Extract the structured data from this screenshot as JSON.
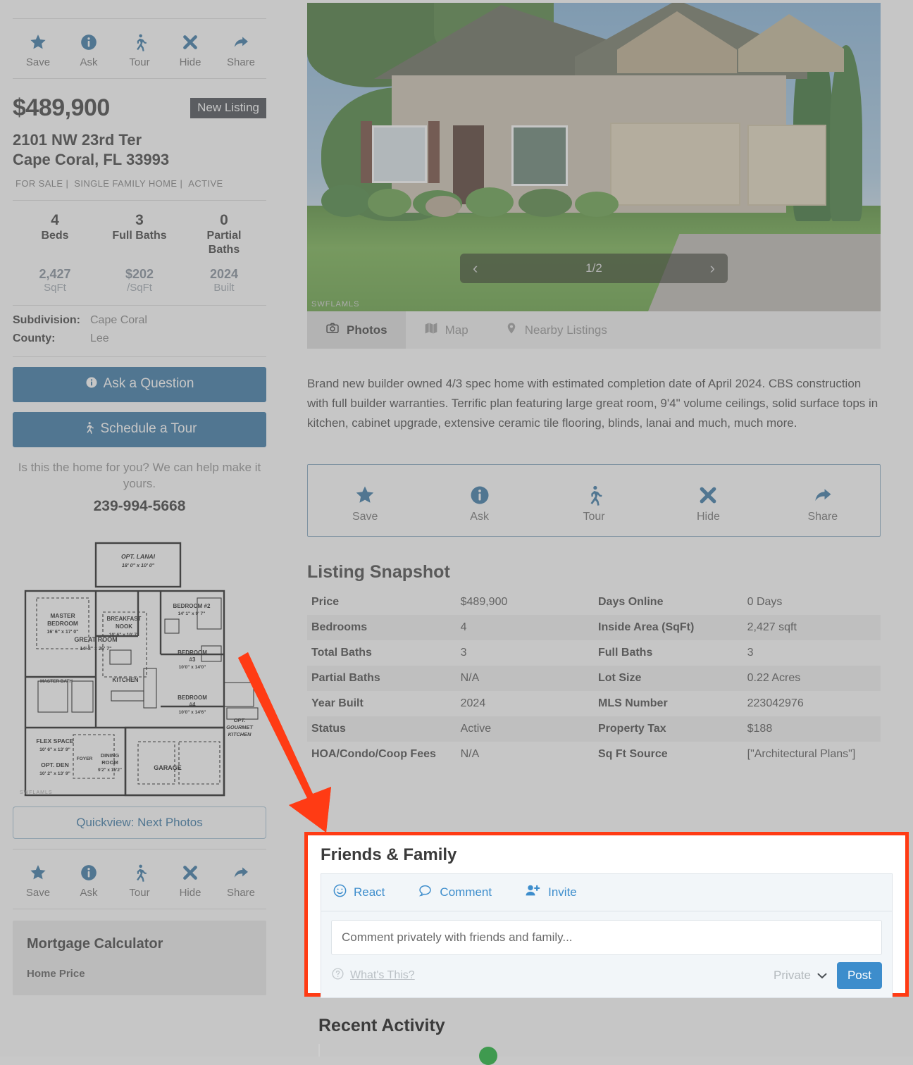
{
  "sidebar": {
    "actions": [
      {
        "label": "Save",
        "icon": "star-icon"
      },
      {
        "label": "Ask",
        "icon": "info-circle-icon"
      },
      {
        "label": "Tour",
        "icon": "walking-person-icon"
      },
      {
        "label": "Hide",
        "icon": "close-x-icon"
      },
      {
        "label": "Share",
        "icon": "share-arrow-icon"
      }
    ],
    "price": "$489,900",
    "badge": "New Listing",
    "address_line1": "2101 NW 23rd Ter",
    "address_line2": "Cape Coral, FL 33993",
    "meta": [
      "FOR SALE",
      "SINGLE FAMILY HOME",
      "ACTIVE"
    ],
    "stats_primary": [
      {
        "value": "4",
        "label": "Beds"
      },
      {
        "value": "3",
        "label": "Full Baths"
      },
      {
        "value": "0",
        "label": "Partial Baths"
      }
    ],
    "stats_secondary": [
      {
        "value": "2,427",
        "label": "SqFt"
      },
      {
        "value": "$202",
        "label": "/SqFt"
      },
      {
        "value": "2024",
        "label": "Built"
      }
    ],
    "details": [
      {
        "key": "Subdivision:",
        "value": "Cape Coral"
      },
      {
        "key": "County:",
        "value": "Lee"
      }
    ],
    "ask_button": "Ask a Question",
    "tour_button": "Schedule a Tour",
    "help_text": "Is this the home for you? We can help make it yours.",
    "phone": "239-994-5668",
    "quickview_button": "Quickview: Next Photos",
    "floorplan": {
      "watermark": "SWFLAMLS",
      "rooms": [
        {
          "name": "OPT. LANAI",
          "dims": "18' 0\" x 10' 0\""
        },
        {
          "name": "MASTER BEDROOM",
          "dims": "16' 6\" x 17' 0\""
        },
        {
          "name": "BEDROOM #2",
          "dims": "14' 1\" x 9' 7\""
        },
        {
          "name": "BREAKFAST NOOK",
          "dims": "10' 6\" x 10' 7\""
        },
        {
          "name": "GREAT ROOM",
          "dims": "14' 8\" x 26' 7\""
        },
        {
          "name": "BEDROOM #3",
          "dims": "10'0\" x 14'0\""
        },
        {
          "name": "KITCHEN",
          "dims": ""
        },
        {
          "name": "BEDROOM #4",
          "dims": "10'0\" x 14'6\""
        },
        {
          "name": "MASTER BATH",
          "dims": ""
        },
        {
          "name": "FLEX SPACE",
          "dims": "10' 6\" x 13' 9\""
        },
        {
          "name": "OPT. DEN",
          "dims": "10' 2\" x 13' 9\""
        },
        {
          "name": "FOYER",
          "dims": ""
        },
        {
          "name": "DINING ROOM",
          "dims": "9'2\" x 15'2\""
        },
        {
          "name": "GARAGE",
          "dims": ""
        },
        {
          "name": "OPT. GOURMET KITCHEN",
          "dims": ""
        }
      ]
    },
    "mortgage": {
      "title": "Mortgage Calculator",
      "field_label": "Home Price"
    }
  },
  "main": {
    "photo": {
      "counter": "1/2",
      "prev_icon": "chevron-left-icon",
      "next_icon": "chevron-right-icon",
      "watermark": "SWFLAMLS"
    },
    "photo_tabs": [
      {
        "label": "Photos",
        "icon": "camera-icon",
        "active": true
      },
      {
        "label": "Map",
        "icon": "map-icon",
        "active": false
      },
      {
        "label": "Nearby Listings",
        "icon": "map-pin-icon",
        "active": false
      }
    ],
    "description": "Brand new builder owned 4/3 spec home with estimated completion date of April 2024. CBS construction with full builder warranties. Terrific plan featuring large great room, 9'4\" volume ceilings, solid surface tops in kitchen, cabinet upgrade, extensive ceramic tile flooring, blinds, lanai and much, much more.",
    "actions": [
      {
        "label": "Save",
        "icon": "star-icon"
      },
      {
        "label": "Ask",
        "icon": "info-circle-icon"
      },
      {
        "label": "Tour",
        "icon": "walking-person-icon"
      },
      {
        "label": "Hide",
        "icon": "close-x-icon"
      },
      {
        "label": "Share",
        "icon": "share-arrow-icon"
      }
    ],
    "snapshot": {
      "title": "Listing Snapshot",
      "left": [
        {
          "key": "Price",
          "value": "$489,900"
        },
        {
          "key": "Bedrooms",
          "value": "4"
        },
        {
          "key": "Total Baths",
          "value": "3"
        },
        {
          "key": "Partial Baths",
          "value": "N/A"
        },
        {
          "key": "Year Built",
          "value": "2024"
        },
        {
          "key": "Status",
          "value": "Active"
        },
        {
          "key": "HOA/Condo/Coop Fees",
          "value": "N/A"
        }
      ],
      "right": [
        {
          "key": "Days Online",
          "value": "0 Days"
        },
        {
          "key": "Inside Area (SqFt)",
          "value": "2,427 sqft"
        },
        {
          "key": "Full Baths",
          "value": "3"
        },
        {
          "key": "Lot Size",
          "value": "0.22 Acres"
        },
        {
          "key": "MLS Number",
          "value": "223042976"
        },
        {
          "key": "Property Tax",
          "value": "$188"
        },
        {
          "key": "Sq Ft Source",
          "value": "[\"Architectural Plans\"]"
        }
      ]
    },
    "friends_family": {
      "title": "Friends & Family",
      "tools": [
        {
          "label": "React",
          "icon": "smiley-face-icon"
        },
        {
          "label": "Comment",
          "icon": "speech-bubble-icon"
        },
        {
          "label": "Invite",
          "icon": "person-add-icon"
        }
      ],
      "comment_placeholder": "Comment privately with friends and family...",
      "whats_this": "What's This?",
      "whats_this_icon": "question-circle-icon",
      "privacy_value": "Private",
      "privacy_icon": "chevron-down-icon",
      "post_button": "Post"
    },
    "recent_activity_title": "Recent Activity"
  },
  "annotation": {
    "highlight_color": "#ff3b14",
    "arrow_color": "#ff3b14"
  },
  "colors": {
    "accent_blue": "#2b6e9e",
    "link_blue": "#3d8dcc",
    "badge_dark": "#3c4148"
  }
}
